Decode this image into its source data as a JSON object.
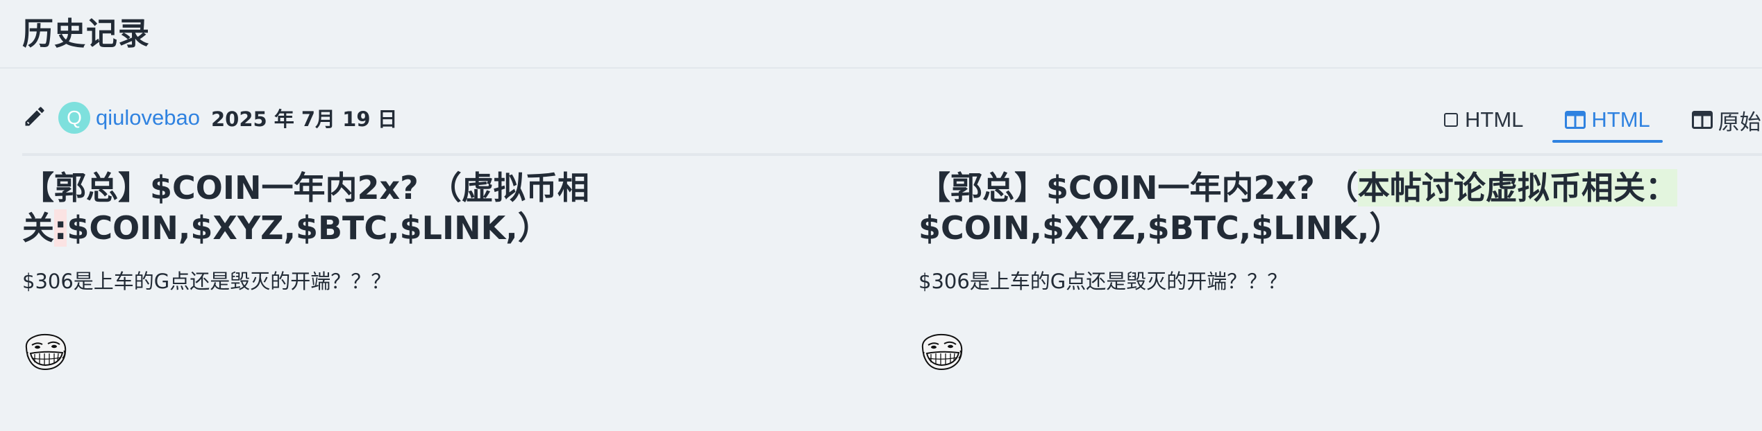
{
  "page": {
    "title": "历史记录"
  },
  "revision": {
    "editor_icon": "pencil-icon",
    "avatar_letter": "Q",
    "avatar_color": "#7ee0dd",
    "username": "qiulovebao",
    "date": "2025 年 7月 19 日"
  },
  "tabs": [
    {
      "label": "HTML",
      "icon": "square-icon",
      "active": false
    },
    {
      "label": "HTML",
      "icon": "split-view-icon",
      "active": true
    },
    {
      "label": "原始",
      "icon": "split-view-icon",
      "active": false
    }
  ],
  "diff": {
    "left": {
      "title_before": "【郭总】$COIN一年内2x? （虚拟币相关",
      "title_removed": ":",
      "title_after": "$COIN,$XYZ,$BTC,$LINK,）",
      "body": "$306是上车的G点还是毁灭的开端？？？",
      "image_icon": "troll-face-icon"
    },
    "right": {
      "title_before": "【郭总】$COIN一年内2x? （",
      "title_added": "本帖讨论虚拟币相关：",
      "title_after": "$COIN,$XYZ,$BTC,$LINK,）",
      "body": "$306是上车的G点还是毁灭的开端？？？",
      "image_icon": "troll-face-icon"
    }
  },
  "colors": {
    "accent": "#2f82e0",
    "removed_highlight": "#fbe3e3",
    "added_highlight": "#e3f5de",
    "background": "#eef2f5"
  }
}
